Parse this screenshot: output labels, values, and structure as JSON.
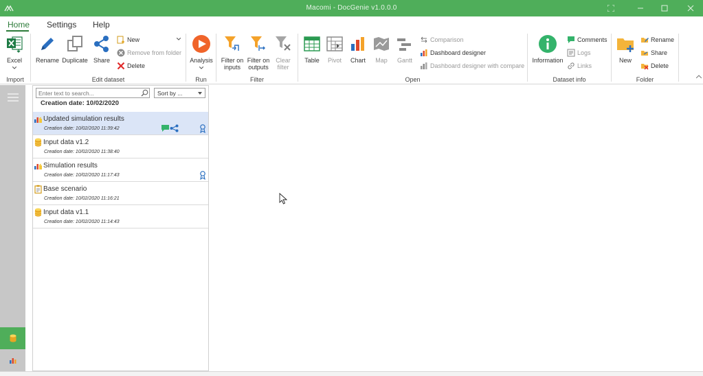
{
  "app": {
    "title": "Macomi - DocGenie v1.0.0.0",
    "accent": "#4fae5a"
  },
  "menu": {
    "tabs": [
      {
        "label": "Home",
        "active": true
      },
      {
        "label": "Settings",
        "active": false
      },
      {
        "label": "Help",
        "active": false
      }
    ]
  },
  "ribbon": {
    "import": {
      "label": "Import",
      "excel": "Excel"
    },
    "edit_dataset": {
      "label": "Edit dataset",
      "rename": "Rename",
      "duplicate": "Duplicate",
      "share": "Share",
      "new": "New",
      "remove_from_folder": "Remove from folder",
      "delete": "Delete"
    },
    "run": {
      "label": "Run",
      "analysis": "Analysis"
    },
    "filter": {
      "label": "Filter",
      "filter_inputs_1": "Filter on",
      "filter_inputs_2": "inputs",
      "filter_outputs_1": "Filter on",
      "filter_outputs_2": "outputs",
      "clear_1": "Clear",
      "clear_2": "filter"
    },
    "open": {
      "label": "Open",
      "table": "Table",
      "pivot": "Pivot",
      "chart": "Chart",
      "map": "Map",
      "gantt": "Gantt",
      "comparison": "Comparison",
      "dashboard_designer": "Dashboard designer",
      "dashboard_designer_compare": "Dashboard designer with compare"
    },
    "dataset_info": {
      "label": "Dataset info",
      "information": "Information",
      "comments": "Comments",
      "logs": "Logs",
      "links": "Links"
    },
    "folder": {
      "label": "Folder",
      "new": "New",
      "rename": "Rename",
      "share": "Share",
      "delete": "Delete"
    }
  },
  "list": {
    "search_placeholder": "Enter text to search...",
    "sort_label": "Sort by ...",
    "group_header": "Creation date: 10/02/2020",
    "items": [
      {
        "name": "Updated simulation results",
        "date": "Creation date: 10/02/2020 11:39:42",
        "icon": "results-icon",
        "selected": true,
        "comment": true,
        "shared": true,
        "badge": true
      },
      {
        "name": "Input data v1.2",
        "date": "Creation date: 10/02/2020 11:38:40",
        "icon": "database-icon"
      },
      {
        "name": "Simulation results",
        "date": "Creation date: 10/02/2020 11:17:43",
        "icon": "results-icon",
        "badge": true
      },
      {
        "name": "Base scenario",
        "date": "Creation date: 10/02/2020 11:16:21",
        "icon": "clipboard-icon"
      },
      {
        "name": "Input data v1.1",
        "date": "Creation date: 10/02/2020 11:14:43",
        "icon": "database-icon"
      }
    ]
  }
}
